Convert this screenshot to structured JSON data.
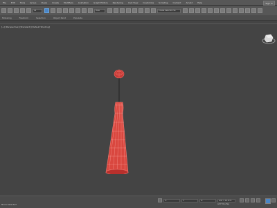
{
  "menu": {
    "items": [
      "File",
      "Edit",
      "Tools",
      "Group",
      "Views",
      "Create",
      "Modifiers",
      "Animation",
      "Graph Editors",
      "Rendering",
      "Civil View",
      "Customize",
      "Scripting",
      "Content",
      "Arnold",
      "Help"
    ],
    "sign_in": "Sign In"
  },
  "toolbar": {
    "filter_value": "All",
    "view_value": "View",
    "selection_set_placeholder": "Create Selection Se"
  },
  "ribbon": {
    "tabs": [
      "Modeling",
      "Freeform",
      "Selection",
      "Object Paint",
      "Populate"
    ]
  },
  "viewport": {
    "label": "[+] [Perspective] [Standard] [Default Shading]"
  },
  "status": {
    "text": "None Selected",
    "coords": {
      "x": "X:",
      "y": "Y:",
      "z": "Z:"
    },
    "grid": "Grid = 10.0cm",
    "add_time_tag": "Add Time Tag"
  },
  "colors": {
    "accent": "#4a86c8",
    "wireframe": "#e8544f",
    "viewport_bg": "#444444"
  }
}
